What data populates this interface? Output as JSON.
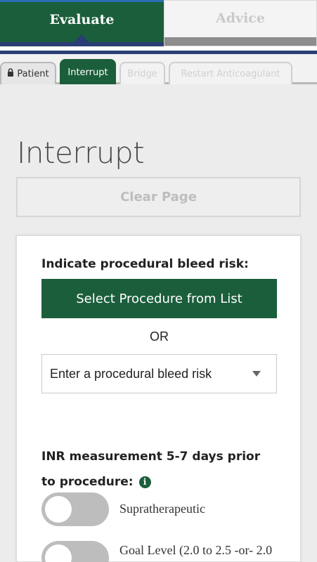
{
  "top_tabs": {
    "evaluate": "Evaluate",
    "advice": "Advice"
  },
  "sub_tabs": {
    "patient": "Patient",
    "interrupt": "Interrupt",
    "bridge": "Bridge",
    "restart": "Restart Anticoagulant"
  },
  "page": {
    "title": "Interrupt",
    "clear_label": "Clear Page"
  },
  "card": {
    "bleed_label": "Indicate procedural bleed risk:",
    "select_procedure_label": "Select Procedure from List",
    "or_text": "OR",
    "risk_select_value": "Enter a procedural bleed risk",
    "inr_label_line1": "INR measurement 5-7 days prior",
    "inr_label_line2": "to procedure:",
    "info_icon_glyph": "i",
    "options": [
      {
        "label": "Supratherapeutic",
        "checked": false
      },
      {
        "label": "Goal Level (2.0 to 2.5 -or- 2.0",
        "checked": false
      }
    ]
  },
  "colors": {
    "brand_green": "#1b5e3b",
    "navy": "#2a3d74",
    "tab_blue_edge": "#2a6fb5"
  },
  "icons": {
    "lock": "lock-icon",
    "caret": "caret-up-icon",
    "dropdown": "chevron-down-icon",
    "info": "info-icon"
  }
}
